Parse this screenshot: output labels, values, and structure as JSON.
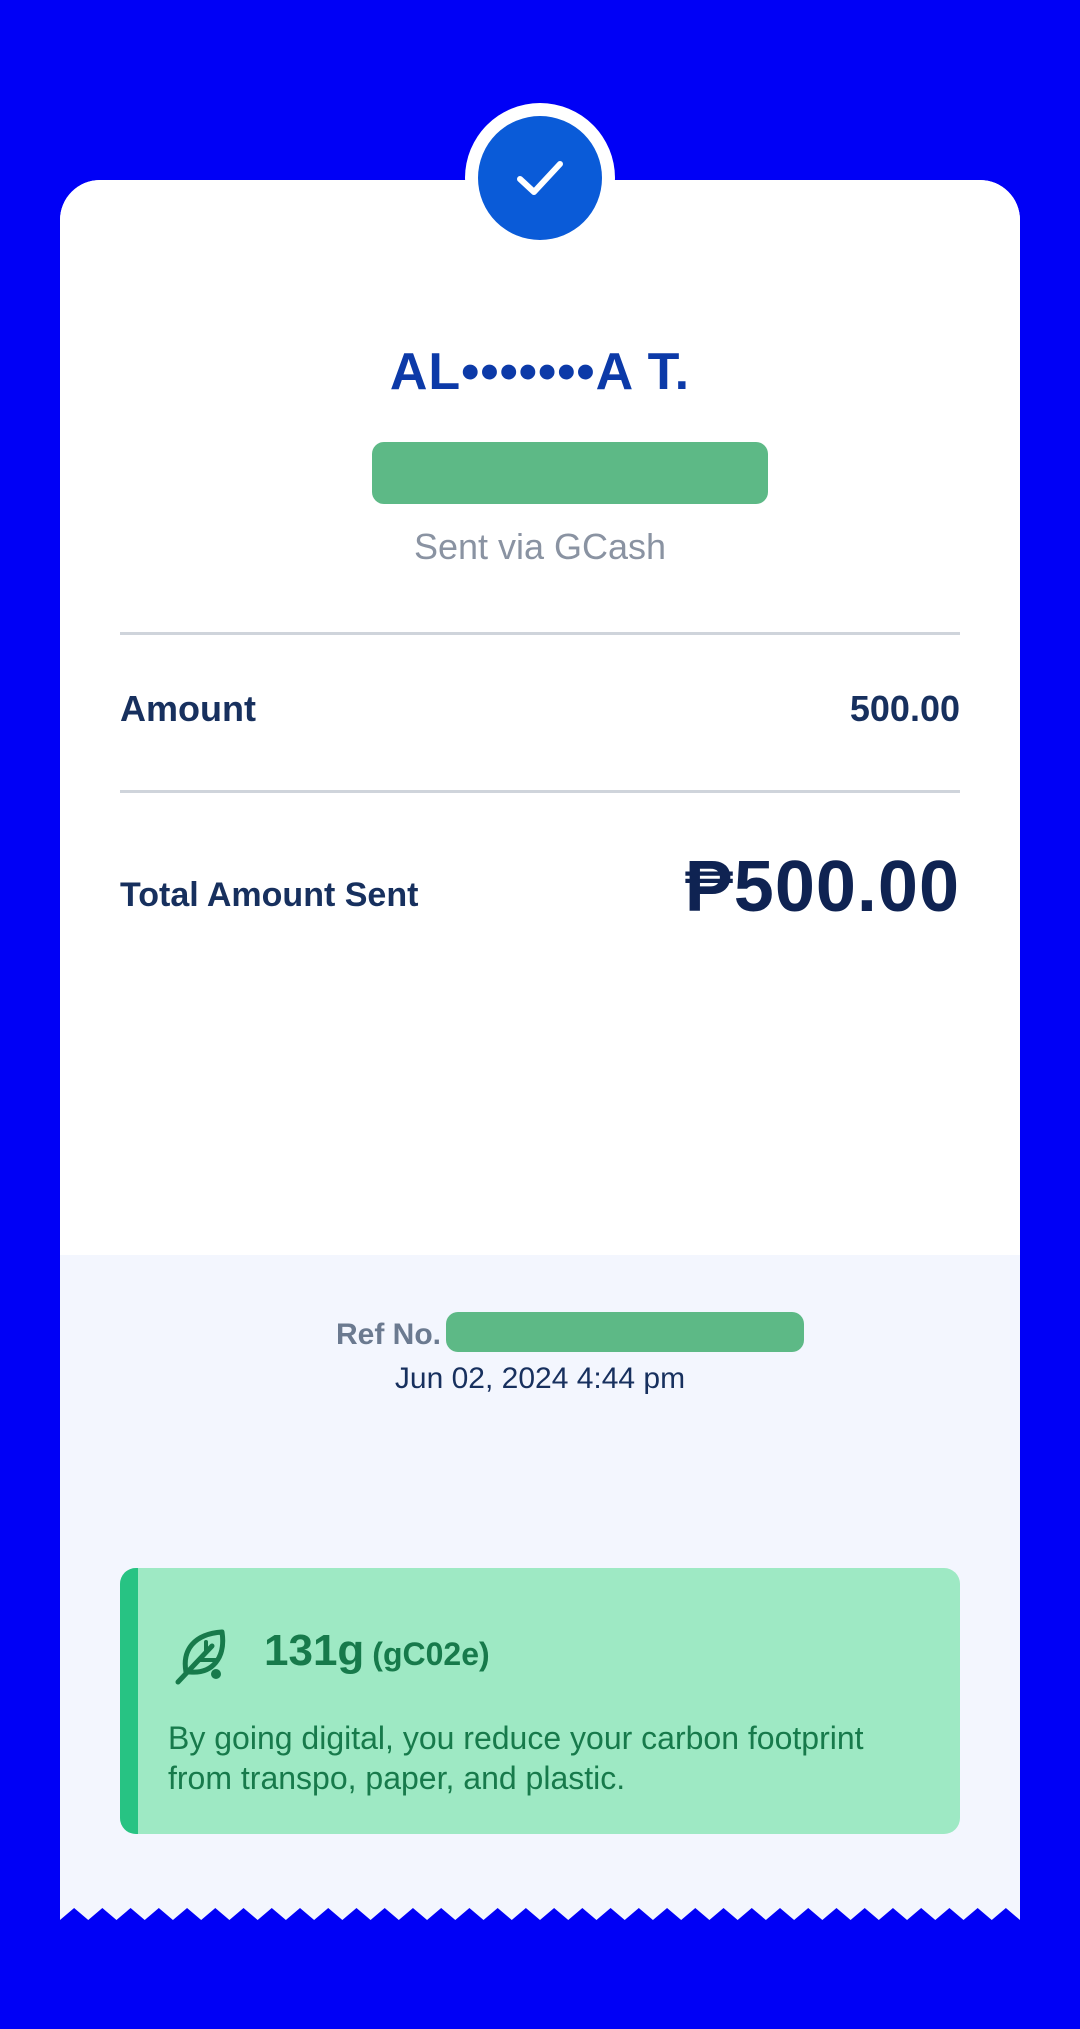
{
  "receipt": {
    "recipient_name": "AL•••••••A T.",
    "sent_via": "Sent via GCash",
    "amount_label": "Amount",
    "amount_value": "500.00",
    "total_label": "Total Amount Sent",
    "total_value": "₱500.00",
    "ref_label": "Ref No.",
    "date_time": "Jun 02, 2024 4:44 pm"
  },
  "eco": {
    "amount": "131g",
    "unit": "(gC02e)",
    "message": "By going digital, you reduce your carbon footprint from transpo, paper, and plastic."
  },
  "icons": {
    "check": "check-icon",
    "leaf": "leaf-icon"
  },
  "colors": {
    "background": "#0000f6",
    "accent": "#0a5bd8",
    "eco_card": "#9ee9c4",
    "eco_text": "#177a4b"
  }
}
